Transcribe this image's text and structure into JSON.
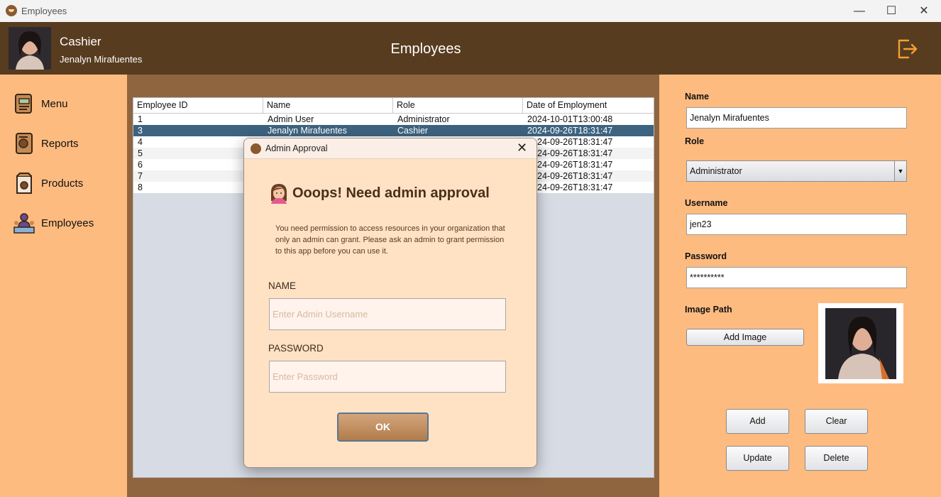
{
  "window": {
    "title": "Employees",
    "minimize_glyph": "—",
    "maximize_glyph": "☐",
    "close_glyph": "✕"
  },
  "header": {
    "role": "Cashier",
    "user_name": "Jenalyn Mirafuentes",
    "page_title": "Employees",
    "logout_icon": "logout-icon",
    "logout_color": "#f4a031"
  },
  "sidebar": {
    "items": [
      {
        "label": "Menu",
        "icon": "menu-icon"
      },
      {
        "label": "Reports",
        "icon": "reports-icon"
      },
      {
        "label": "Products",
        "icon": "products-icon"
      },
      {
        "label": "Employees",
        "icon": "employees-icon"
      }
    ]
  },
  "table": {
    "columns": [
      "Employee ID",
      "Name",
      "Role",
      "Date of Employment"
    ],
    "rows": [
      {
        "id": "1",
        "name": "Admin User",
        "role": "Administrator",
        "date": "2024-10-01T13:00:48"
      },
      {
        "id": "3",
        "name": "Jenalyn Mirafuentes",
        "role": "Cashier",
        "date": "2024-09-26T18:31:47"
      },
      {
        "id": "4",
        "name": "",
        "role": "",
        "date": "24-09-26T18:31:47"
      },
      {
        "id": "5",
        "name": "",
        "role": "",
        "date": "24-09-26T18:31:47"
      },
      {
        "id": "6",
        "name": "",
        "role": "",
        "date": "24-09-26T18:31:47"
      },
      {
        "id": "7",
        "name": "",
        "role": "",
        "date": "24-09-26T18:31:47"
      },
      {
        "id": "8",
        "name": "",
        "role": "",
        "date": "24-09-26T18:31:47"
      }
    ],
    "selected_row_color": "#3d6380"
  },
  "form": {
    "name_label": "Name",
    "name_value": "Jenalyn Mirafuentes",
    "role_label": "Role",
    "role_value": "Administrator",
    "username_label": "Username",
    "username_value": "jen23",
    "password_label": "Password",
    "password_value": "**********",
    "image_label": "Image Path",
    "add_image_label": "Add Image",
    "add_label": "Add",
    "clear_label": "Clear",
    "update_label": "Update",
    "delete_label": "Delete"
  },
  "dialog": {
    "title": "Admin Approval",
    "close_glyph": "✕",
    "heading": "Ooops! Need admin approval",
    "message": "You need permission to access resources in your organization that only an admin can grant. Please ask an admin to grant permission to this app before you can use it.",
    "name_label": "NAME",
    "name_placeholder": "Enter Admin Username",
    "password_label": "PASSWORD",
    "password_placeholder": "Enter Password",
    "ok_label": "OK"
  },
  "colors": {
    "header_bg": "#583c1f",
    "panel_bg": "#fdbb80",
    "middle_bg": "#8f6540",
    "dialog_bg": "#ffe2c4"
  }
}
